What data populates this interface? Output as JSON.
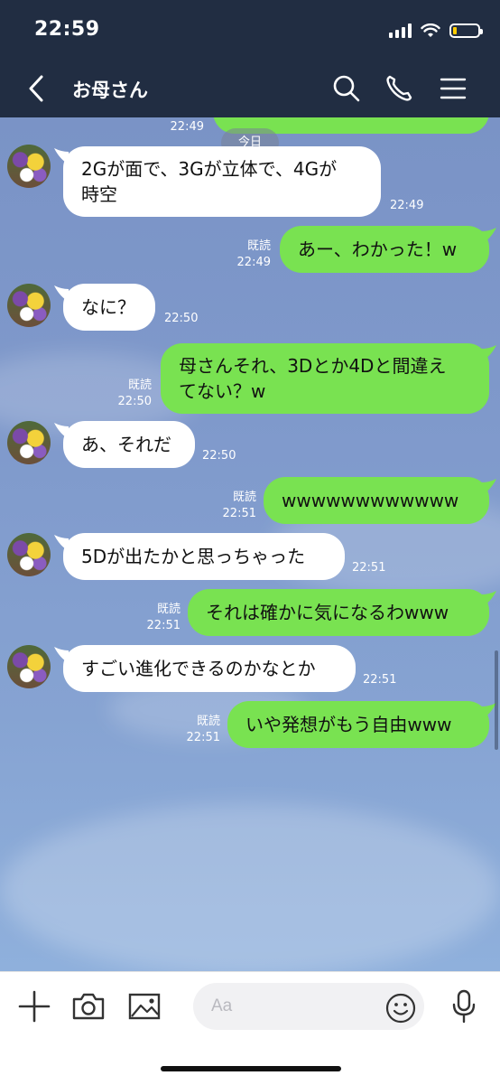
{
  "status_bar": {
    "time": "22:59"
  },
  "header": {
    "title": "お母さん"
  },
  "chat": {
    "date_label": "今日",
    "top_partial_time": "22:49",
    "messages": [
      {
        "side": "left",
        "lines": [
          "2Gが面で、3Gが立体で、4Gが",
          "時空"
        ],
        "time": "22:49"
      },
      {
        "side": "right",
        "text": "あー、わかった！w",
        "read": "既読",
        "time": "22:49"
      },
      {
        "side": "left",
        "text": "なに？",
        "time": "22:50"
      },
      {
        "side": "right",
        "lines": [
          "母さんそれ、3Dとか4Dと間違え",
          "てない？w"
        ],
        "read": "既読",
        "time": "22:50"
      },
      {
        "side": "left",
        "text": "あ、それだ",
        "time": "22:50"
      },
      {
        "side": "right",
        "text": "wwwwwwwwwwww",
        "read": "既読",
        "time": "22:51"
      },
      {
        "side": "left",
        "text": "5Dが出たかと思っちゃった",
        "time": "22:51"
      },
      {
        "side": "right",
        "text": "それは確かに気になるわwww",
        "read": "既読",
        "time": "22:51"
      },
      {
        "side": "left",
        "text": "すごい進化できるのかなとか",
        "time": "22:51"
      },
      {
        "side": "right",
        "text": "いや発想がもう自由www",
        "read": "既読",
        "time": "22:51"
      }
    ]
  },
  "input": {
    "placeholder": "Aa"
  },
  "colors": {
    "header_bg": "#212d42",
    "outgoing_bubble": "#79e251",
    "incoming_bubble": "#ffffff"
  }
}
